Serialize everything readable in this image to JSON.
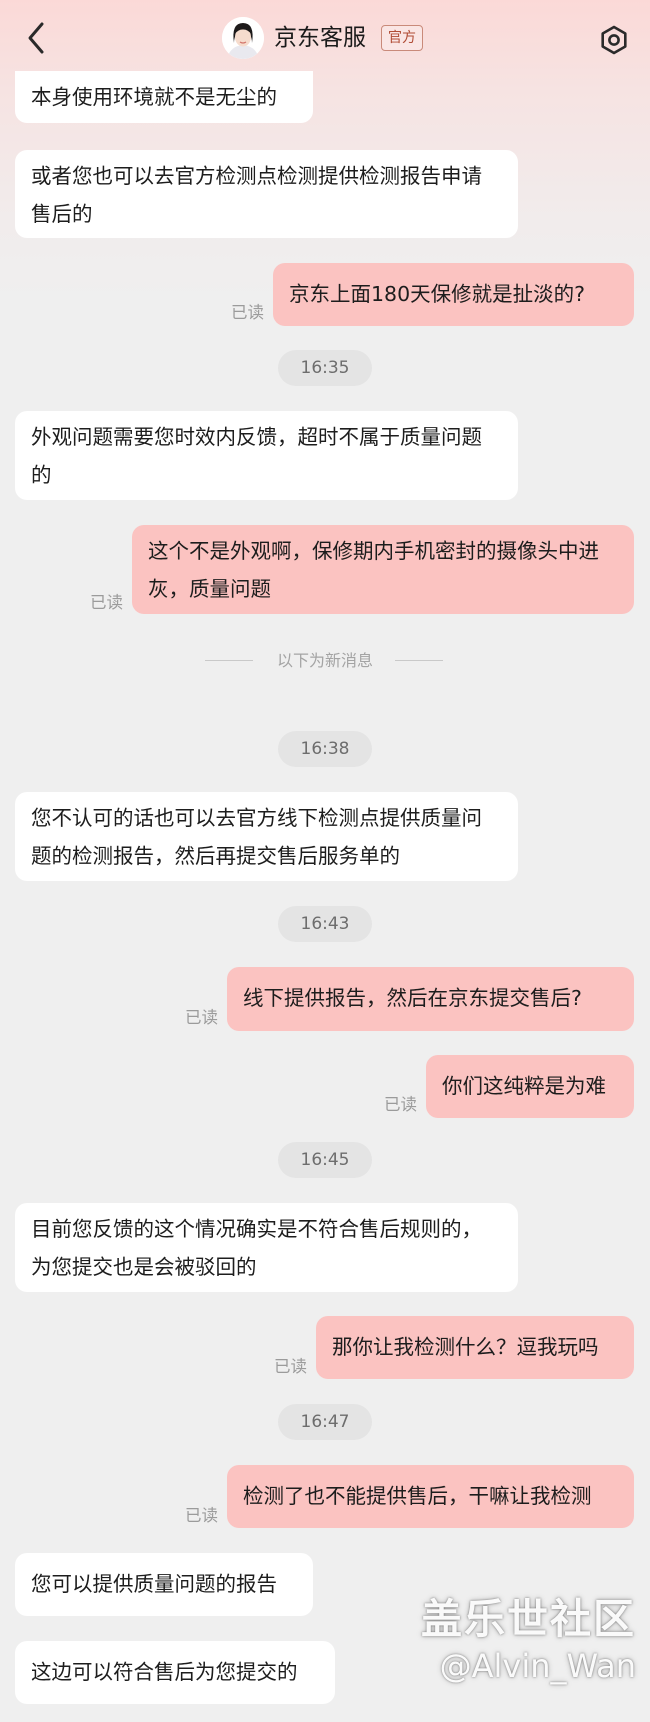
{
  "header": {
    "title": "京东客服",
    "badge": "官方",
    "back_icon": "chevron-left-icon",
    "settings_icon": "settings-hexagon-icon",
    "avatar": "agent-avatar"
  },
  "messages": [
    {
      "side": "in",
      "text": "本身使用环境就不是无尘的"
    },
    {
      "side": "in",
      "text": "或者您也可以去官方检测点检测提供检测报告申请售后的"
    },
    {
      "side": "out",
      "text": "京东上面180天保修就是扯淡的?",
      "status": "已读"
    },
    {
      "time": "16:35"
    },
    {
      "side": "in",
      "text": "外观问题需要您时效内反馈，超时不属于质量问题的"
    },
    {
      "side": "out",
      "text": "这个不是外观啊，保修期内手机密封的摄像头中进灰，质量问题",
      "status": "已读"
    },
    {
      "divider": "以下为新消息"
    },
    {
      "time": "16:38"
    },
    {
      "side": "in",
      "text": "您不认可的话也可以去官方线下检测点提供质量问题的检测报告，然后再提交售后服务单的"
    },
    {
      "time": "16:43"
    },
    {
      "side": "out",
      "text": "线下提供报告，然后在京东提交售后?",
      "status": "已读"
    },
    {
      "side": "out",
      "text": "你们这纯粹是为难",
      "status": "已读"
    },
    {
      "time": "16:45"
    },
    {
      "side": "in",
      "text": "目前您反馈的这个情况确实是不符合售后规则的，为您提交也是会被驳回的"
    },
    {
      "side": "out",
      "text": "那你让我检测什么？逗我玩吗",
      "status": "已读"
    },
    {
      "time": "16:47"
    },
    {
      "side": "out",
      "text": "检测了也不能提供售后，干嘛让我检测",
      "status": "已读"
    },
    {
      "side": "in",
      "text": "您可以提供质量问题的报告"
    },
    {
      "side": "in",
      "text": "这边可以符合售后为您提交的"
    }
  ],
  "watermark": {
    "logo": "盖乐世社区",
    "handle": "@Alvin_Wan"
  },
  "colors": {
    "outgoing_bubble": "#fbc3c1",
    "incoming_bubble": "#ffffff",
    "background": "#efefef",
    "badge": "#b04c35"
  }
}
